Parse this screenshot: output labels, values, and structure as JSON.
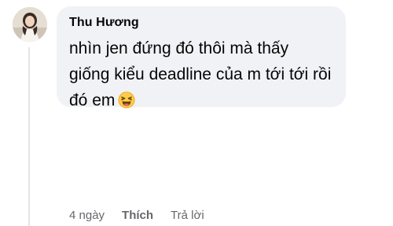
{
  "comment": {
    "author": "Thu Hương",
    "text": "nhìn jen đứng đó thôi mà thấy giống kiểu deadline của m tới tới rồi đó em",
    "emoji_icon": "laughing-squinting-face-icon"
  },
  "actions": {
    "time": "4 ngày",
    "like_label": "Thích",
    "reply_label": "Trả lời"
  },
  "colors": {
    "bubble": "#f0f2f5",
    "text": "#050505",
    "secondary_text": "#65676b",
    "thread_line": "#e3e5e8"
  }
}
